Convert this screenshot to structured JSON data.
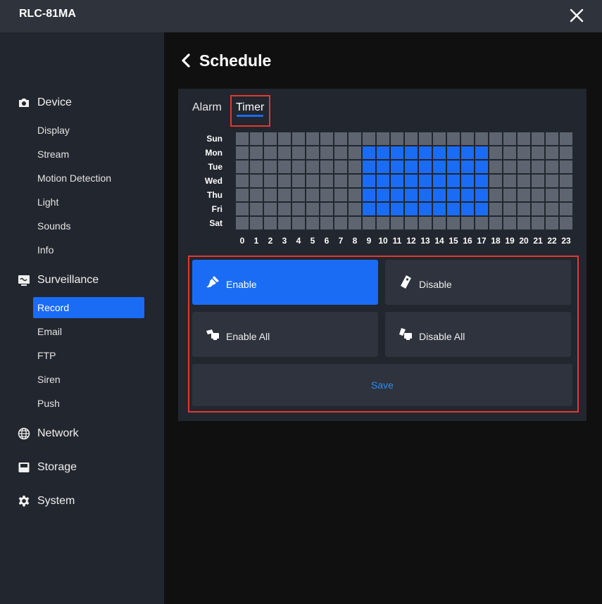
{
  "app": {
    "title": "RLC-81MA"
  },
  "icons": {
    "close": "close-icon",
    "back": "chevron-left-icon"
  },
  "sidebar": {
    "device": {
      "label": "Device",
      "icon": "camera-icon"
    },
    "device_items": [
      "Display",
      "Stream",
      "Motion Detection",
      "Light",
      "Sounds",
      "Info"
    ],
    "surveillance": {
      "label": "Surveillance",
      "icon": "monitor-icon"
    },
    "surveillance_items": [
      "Record",
      "Email",
      "FTP",
      "Siren",
      "Push"
    ],
    "active_item": "Record",
    "network": {
      "label": "Network",
      "icon": "globe-icon"
    },
    "storage": {
      "label": "Storage",
      "icon": "hard-drive-icon"
    },
    "system": {
      "label": "System",
      "icon": "gear-icon"
    }
  },
  "page": {
    "title": "Schedule"
  },
  "tabs": {
    "alarm": "Alarm",
    "timer": "Timer",
    "active": "Timer"
  },
  "schedule": {
    "days": [
      "Sun",
      "Mon",
      "Tue",
      "Wed",
      "Thu",
      "Fri",
      "Sat"
    ],
    "hours": [
      "0",
      "1",
      "2",
      "3",
      "4",
      "5",
      "6",
      "7",
      "8",
      "9",
      "10",
      "11",
      "12",
      "13",
      "14",
      "15",
      "16",
      "17",
      "18",
      "19",
      "20",
      "21",
      "22",
      "23"
    ],
    "active_days": [
      "Mon",
      "Tue",
      "Wed",
      "Thu",
      "Fri"
    ],
    "active_hours": [
      9,
      17
    ]
  },
  "actions": {
    "enable": "Enable",
    "disable": "Disable",
    "enable_all": "Enable All",
    "disable_all": "Disable All",
    "save": "Save"
  },
  "colors": {
    "accent": "#1a6cf5",
    "highlight": "#e03a2f",
    "inactive_cell": "#5f6570"
  }
}
